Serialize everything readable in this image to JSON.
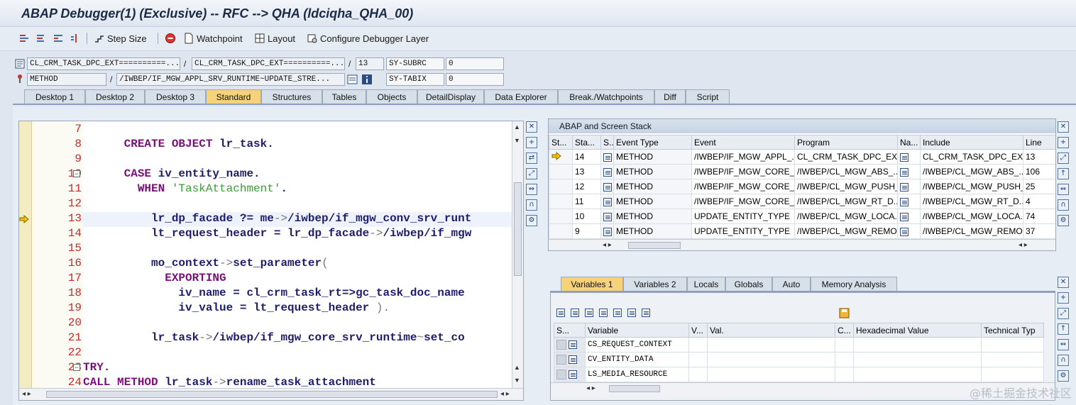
{
  "window": {
    "title": "ABAP Debugger(1)  (Exclusive) -- RFC --> QHA (ldciqha_QHA_00)"
  },
  "toolbar": {
    "step_size": "Step Size",
    "watchpoint": "Watchpoint",
    "layout": "Layout",
    "configure": "Configure Debugger Layer"
  },
  "fields": {
    "row1": {
      "class": "CL_CRM_TASK_DPC_EXT==========...",
      "include": "CL_CRM_TASK_DPC_EXT==========...",
      "line": "13",
      "sysfield": "SY-SUBRC",
      "sysvalue": "0"
    },
    "row2": {
      "type": "METHOD",
      "method": "/IWBEP/IF_MGW_APPL_SRV_RUNTIME~UPDATE_STRE...",
      "sysfield": "SY-TABIX",
      "sysvalue": "0"
    }
  },
  "tabs": [
    "Desktop 1",
    "Desktop 2",
    "Desktop 3",
    "Standard",
    "Structures",
    "Tables",
    "Objects",
    "DetailDisplay",
    "Data Explorer",
    "Break./Watchpoints",
    "Diff",
    "Script"
  ],
  "active_tab": "Standard",
  "code": {
    "lines": [
      {
        "n": "7",
        "parts": []
      },
      {
        "n": "8",
        "parts": [
          [
            "      ",
            ""
          ],
          [
            "CREATE OBJECT",
            "kw"
          ],
          [
            " lr_task.",
            "id"
          ]
        ]
      },
      {
        "n": "9",
        "parts": []
      },
      {
        "n": "10",
        "parts": [
          [
            "      ",
            ""
          ],
          [
            "CASE",
            "kw"
          ],
          [
            " iv_entity_name.",
            "id"
          ]
        ]
      },
      {
        "n": "11",
        "parts": [
          [
            "        ",
            ""
          ],
          [
            "WHEN",
            "kw"
          ],
          [
            " ",
            ""
          ],
          [
            "'TaskAttachment'",
            "str"
          ],
          [
            ".",
            "id"
          ]
        ]
      },
      {
        "n": "12",
        "parts": []
      },
      {
        "n": "13",
        "parts": [
          [
            "          lr_dp_facade ?= me",
            "id"
          ],
          [
            "->",
            "op"
          ],
          [
            "/iwbep/if_mgw_conv_srv_runt",
            "id"
          ]
        ]
      },
      {
        "n": "14",
        "parts": [
          [
            "          lt_request_header = lr_dp_facade",
            "id"
          ],
          [
            "->",
            "op"
          ],
          [
            "/iwbep/if_mgw",
            "id"
          ]
        ]
      },
      {
        "n": "15",
        "parts": []
      },
      {
        "n": "16",
        "parts": [
          [
            "          mo_context",
            "id"
          ],
          [
            "->",
            "op"
          ],
          [
            "set_parameter",
            "id"
          ],
          [
            "(",
            "op"
          ]
        ]
      },
      {
        "n": "17",
        "parts": [
          [
            "            ",
            ""
          ],
          [
            "EXPORTING",
            "kw"
          ]
        ]
      },
      {
        "n": "18",
        "parts": [
          [
            "              iv_name = cl_crm_task_rt=>gc_task_doc_name",
            "id"
          ]
        ]
      },
      {
        "n": "19",
        "parts": [
          [
            "              iv_value = lt_request_header ",
            "id"
          ],
          [
            ").",
            "op"
          ]
        ]
      },
      {
        "n": "20",
        "parts": []
      },
      {
        "n": "21",
        "parts": [
          [
            "          lr_task",
            "id"
          ],
          [
            "->",
            "op"
          ],
          [
            "/iwbep/if_mgw_core_srv_runtime",
            "id"
          ],
          [
            "~",
            "op"
          ],
          [
            "set_co",
            "id"
          ]
        ]
      },
      {
        "n": "22",
        "parts": []
      },
      {
        "n": "23",
        "parts": [
          [
            "",
            ""
          ],
          [
            "TRY.",
            "kw"
          ]
        ]
      },
      {
        "n": "24",
        "parts": [
          [
            "",
            ""
          ],
          [
            "CALL METHOD",
            "kw"
          ],
          [
            " lr_task",
            "id"
          ],
          [
            "->",
            "op"
          ],
          [
            "rename_task_attachment",
            "id"
          ]
        ]
      }
    ]
  },
  "stack": {
    "title": "ABAP and Screen Stack",
    "headers": [
      "St...",
      "Sta...",
      "S...",
      "Event Type",
      "Event",
      "Program",
      "Na...",
      "Include",
      "Line"
    ],
    "rows": [
      {
        "level": "14",
        "type": "METHOD",
        "event": "/IWBEP/IF_MGW_APPL_...",
        "program": "CL_CRM_TASK_DPC_EXT...",
        "include": "CL_CRM_TASK_DPC_EXT...",
        "line": "13",
        "current": true
      },
      {
        "level": "13",
        "type": "METHOD",
        "event": "/IWBEP/IF_MGW_CORE_...",
        "program": "/IWBEP/CL_MGW_ABS_...",
        "include": "/IWBEP/CL_MGW_ABS_...",
        "line": "106",
        "current": false
      },
      {
        "level": "12",
        "type": "METHOD",
        "event": "/IWBEP/IF_MGW_CORE_...",
        "program": "/IWBEP/CL_MGW_PUSH_...",
        "include": "/IWBEP/CL_MGW_PUSH_...",
        "line": "25",
        "current": false
      },
      {
        "level": "11",
        "type": "METHOD",
        "event": "/IWBEP/IF_MGW_CORE_...",
        "program": "/IWBEP/CL_MGW_RT_D...",
        "include": "/IWBEP/CL_MGW_RT_D...",
        "line": "4",
        "current": false
      },
      {
        "level": "10",
        "type": "METHOD",
        "event": "UPDATE_ENTITY_TYPE",
        "program": "/IWBEP/CL_MGW_LOCA...",
        "include": "/IWBEP/CL_MGW_LOCA...",
        "line": "74",
        "current": false
      },
      {
        "level": "9",
        "type": "METHOD",
        "event": "UPDATE_ENTITY_TYPE",
        "program": "/IWBEP/CL_MGW_REMO...",
        "include": "/IWBEP/CL_MGW_REMO...",
        "line": "37",
        "current": false
      }
    ]
  },
  "vars": {
    "tabs": [
      "Variables 1",
      "Variables 2",
      "Locals",
      "Globals",
      "Auto",
      "Memory Analysis"
    ],
    "active_tab": "Variables 1",
    "headers": [
      "S...",
      "Variable",
      "V...",
      "Val.",
      "C...",
      "Hexadecimal Value",
      "Technical Typ"
    ],
    "rows": [
      {
        "name": "CS_REQUEST_CONTEXT"
      },
      {
        "name": "CV_ENTITY_DATA"
      },
      {
        "name": "LS_MEDIA_RESOURCE"
      }
    ]
  },
  "watermark": "@稀土掘金技术社区"
}
